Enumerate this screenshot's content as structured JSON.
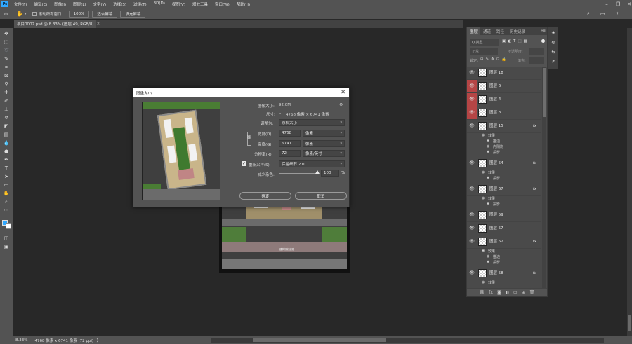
{
  "menu": [
    "文件(F)",
    "编辑(E)",
    "图像(I)",
    "图层(L)",
    "文字(Y)",
    "选择(S)",
    "滤镜(T)",
    "3D(D)",
    "视图(V)",
    "增效工具",
    "窗口(W)",
    "帮助(H)"
  ],
  "options": {
    "scroll_all": "滚动所有窗口",
    "zoom": "100%",
    "fit_screen": "适合屏幕",
    "fill_screen": "填充屏幕"
  },
  "doc_tab": {
    "title": "项目0002.psd @ 8.33% (图层 49, RGB/8)",
    "close": "×"
  },
  "status": {
    "zoom": "8.33%",
    "info": "4768 像素 x 6741 像素 (72 ppi)"
  },
  "dialog": {
    "title": "图像大小",
    "image_size_label": "图像大小:",
    "image_size_value": "92.0M",
    "dimensions_label": "尺寸:",
    "dimensions_value": "4768 像素 × 6741 像素",
    "fit_label": "调整为:",
    "fit_value": "原稿大小",
    "width_label": "宽度(D):",
    "width_value": "4768",
    "width_unit": "像素",
    "height_label": "高度(G):",
    "height_value": "6741",
    "height_unit": "像素",
    "resolution_label": "分辨率(R):",
    "resolution_value": "72",
    "resolution_unit": "像素/英寸",
    "resample_label": "重新采样(S):",
    "resample_value": "保留细节 2.0",
    "noise_label": "减少杂色:",
    "noise_value": "100",
    "noise_unit": "%",
    "ok": "确定",
    "cancel": "取消"
  },
  "panel": {
    "tabs": [
      "图层",
      "通道",
      "路径",
      "历史记录"
    ],
    "kind_placeholder": "Q 类型",
    "blend": "正常",
    "opacity_label": "不透明度:",
    "lock_label": "锁定:",
    "fill_label": "填充:",
    "layers": [
      {
        "name": "图层 18",
        "red": false
      },
      {
        "name": "图层 6",
        "red": true
      },
      {
        "name": "图层 4",
        "red": true
      },
      {
        "name": "图层 3",
        "red": true
      },
      {
        "name": "图层 15",
        "fx": "fx",
        "effects": [
          "效果",
          "描边",
          "内阴影",
          "投影"
        ]
      },
      {
        "name": "图层 54",
        "fx": "fx",
        "effects": [
          "效果",
          "投影"
        ]
      },
      {
        "name": "图层 67",
        "fx": "fx",
        "effects": [
          "效果",
          "投影"
        ]
      },
      {
        "name": "图层 59"
      },
      {
        "name": "图层 57"
      },
      {
        "name": "图层 62",
        "fx": "fx",
        "effects": [
          "效果",
          "描边",
          "投影"
        ]
      },
      {
        "name": "图层 58",
        "fx": "fx",
        "effects": [
          "效果"
        ]
      }
    ]
  },
  "plan_label": "建筑规划道路",
  "colors": {
    "accent": "#31a8ff",
    "layer_red": "#b54545",
    "panel": "#535353",
    "canvas": "#282828"
  }
}
